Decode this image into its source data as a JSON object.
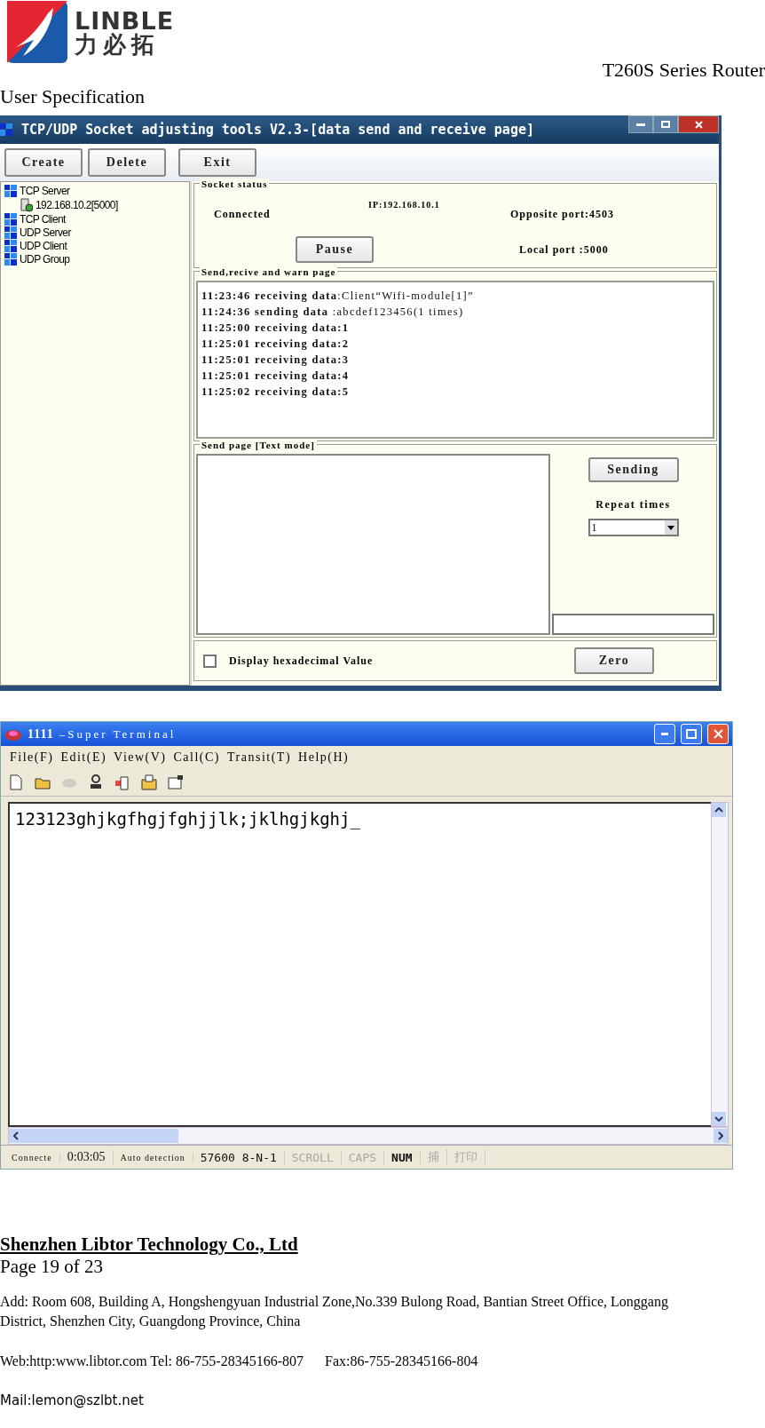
{
  "header": {
    "logo": {
      "wordmark": "LINBLE",
      "chinese": "力必拓"
    },
    "product": "T260S Series Router",
    "doc": "User Specification"
  },
  "socket_tool": {
    "title": "TCP/UDP Socket adjusting tools V2.3-[data send and receive page]",
    "buttons": [
      "Create",
      "Delete",
      "Exit"
    ],
    "tree": [
      {
        "label": "TCP Server",
        "children": [
          {
            "label": "192.168.10.2[5000]"
          }
        ]
      },
      {
        "label": "TCP Client"
      },
      {
        "label": "UDP Server"
      },
      {
        "label": "UDP Client"
      },
      {
        "label": "UDP Group"
      }
    ],
    "status": {
      "legend": "Socket status",
      "state": "Connected",
      "ip": "IP:192.168.10.1",
      "opposite_port": "Opposite port:4503",
      "pause": "Pause",
      "local_port": "Local port :5000"
    },
    "log": {
      "legend": "Send,recive and warn page",
      "lines": [
        "**11:23:46 receiving data**:Client“Wifi-module[1]”",
        "**11:24:36 sending data** :abcdef123456(1 times)",
        "11:25:00 receiving data:1",
        "11:25:01 receiving data:2",
        "11:25:01 receiving data:3",
        "11:25:01 receiving data:4",
        "11:25:02 receiving data:5"
      ]
    },
    "send": {
      "legend": "Send page [Text mode]",
      "send_button": "Sending",
      "repeat_label": "Repeat times",
      "repeat_value": "1"
    },
    "hex": {
      "label": "Display hexadecimal Value",
      "checked": false
    },
    "zero": "Zero"
  },
  "terminal": {
    "title_name": "1111",
    "title_app": "–Super Terminal",
    "menu": [
      "File(F)",
      "Edit(E)",
      "View(V)",
      "Call(C)",
      "Transit(T)",
      "Help(H)"
    ],
    "tools": [
      {
        "kind": "new",
        "disabled": false
      },
      {
        "kind": "open",
        "disabled": false
      },
      {
        "kind": "phone",
        "disabled": true
      },
      {
        "kind": "hangup",
        "disabled": false
      },
      {
        "kind": "send",
        "disabled": false
      },
      {
        "kind": "receive",
        "disabled": false
      },
      {
        "kind": "properties",
        "disabled": false
      }
    ],
    "text": "123123ghjkgfhgjfghjjlk;jklhgjkghj_",
    "status": [
      {
        "text": "Connecte",
        "on": true
      },
      {
        "text": "0:03:05",
        "on": true
      },
      {
        "text": "Auto detection",
        "on": true
      },
      {
        "text": "57600 8-N-1",
        "on": true
      },
      {
        "text": "SCROLL",
        "on": false
      },
      {
        "text": "CAPS",
        "on": false
      },
      {
        "text": "NUM",
        "on": true
      },
      {
        "text": "捕",
        "on": false
      },
      {
        "text": "打印",
        "on": false
      }
    ]
  },
  "footer": {
    "company": "Shenzhen Libtor Technology Co., Ltd",
    "page": "Page 19 of 23",
    "address": "Add: Room 608, Building A, Hongshengyuan Industrial Zone,No.339 Bulong Road, Bantian Street Office, Longgang District, Shenzhen City, Guangdong Province, China",
    "web": "Web:http:www.libtor.com Tel: 86-755-28345166-807",
    "fax": "Fax:86-755-28345166-804",
    "mail": "Mail:lemon@szlbt.net"
  }
}
